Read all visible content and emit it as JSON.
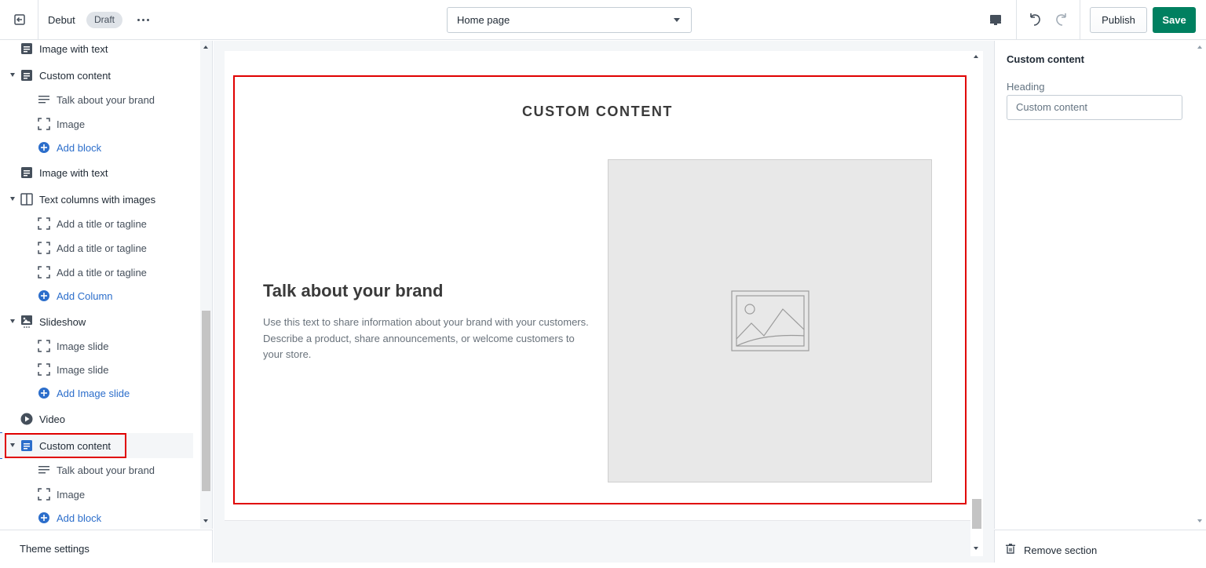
{
  "topbar": {
    "theme_name": "Debut",
    "status_badge": "Draft",
    "page_select": "Home page",
    "publish_label": "Publish",
    "save_label": "Save",
    "accent_green": "#008060"
  },
  "sidebar": {
    "items": [
      {
        "label": "Image with text",
        "icon": "section-icon"
      },
      {
        "label": "Custom content",
        "icon": "section-icon"
      },
      {
        "label": "Talk about your brand",
        "icon": "text-lines-icon"
      },
      {
        "label": "Image",
        "icon": "image-frame-icon"
      },
      {
        "label": "Add block",
        "icon": "add-circle-icon"
      },
      {
        "label": "Image with text",
        "icon": "section-icon"
      },
      {
        "label": "Text columns with images",
        "icon": "columns-icon"
      },
      {
        "label": "Add a title or tagline",
        "icon": "image-frame-icon"
      },
      {
        "label": "Add a title or tagline",
        "icon": "image-frame-icon"
      },
      {
        "label": "Add a title or tagline",
        "icon": "image-frame-icon"
      },
      {
        "label": "Add Column",
        "icon": "add-circle-icon"
      },
      {
        "label": "Slideshow",
        "icon": "slideshow-icon"
      },
      {
        "label": "Image slide",
        "icon": "image-frame-icon"
      },
      {
        "label": "Image slide",
        "icon": "image-frame-icon"
      },
      {
        "label": "Add Image slide",
        "icon": "add-circle-icon"
      },
      {
        "label": "Video",
        "icon": "play-circle-icon"
      },
      {
        "label": "Custom content",
        "icon": "section-icon"
      },
      {
        "label": "Talk about your brand",
        "icon": "text-lines-icon"
      },
      {
        "label": "Image",
        "icon": "image-frame-icon"
      },
      {
        "label": "Add block",
        "icon": "add-circle-icon"
      }
    ],
    "theme_settings": "Theme settings"
  },
  "preview": {
    "section_heading": "CUSTOM CONTENT",
    "brand_title": "Talk about your brand",
    "brand_text": "Use this text to share information about your brand with your customers. Describe a product, share announcements, or welcome customers to your store."
  },
  "settings_panel": {
    "title": "Custom content",
    "heading_label": "Heading",
    "heading_value": "Custom content",
    "remove_section": "Remove section"
  },
  "colors": {
    "highlight_red": "#e00000",
    "link_blue": "#2c6ecb"
  }
}
